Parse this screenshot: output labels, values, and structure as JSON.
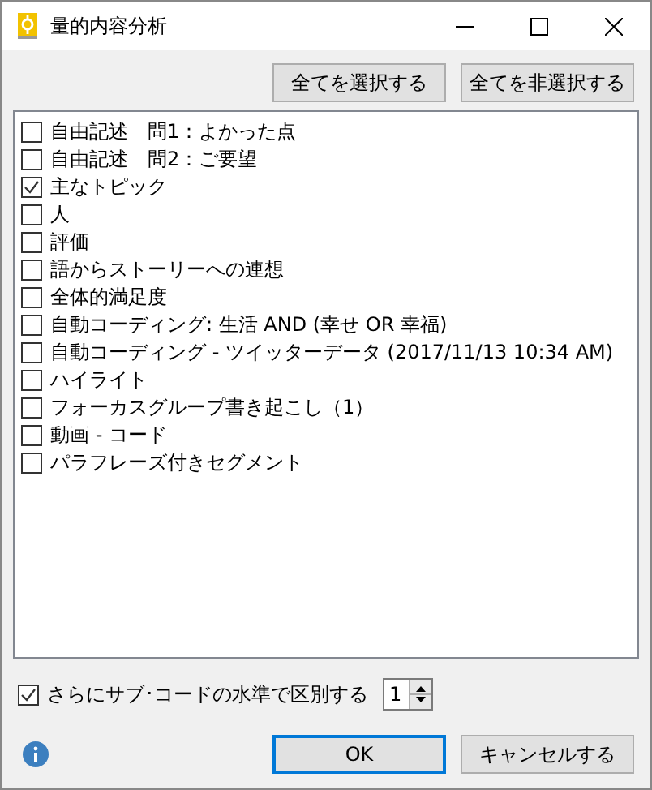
{
  "window": {
    "title": "量的内容分析"
  },
  "top_buttons": [
    "全てを選択する",
    "全てを非選択する"
  ],
  "items": [
    {
      "label": "自由記述　問1：よかった点",
      "checked": false
    },
    {
      "label": "自由記述　問2：ご要望",
      "checked": false
    },
    {
      "label": "主なトピック",
      "checked": true
    },
    {
      "label": "人",
      "checked": false
    },
    {
      "label": "評価",
      "checked": false
    },
    {
      "label": "語からストーリーへの連想",
      "checked": false
    },
    {
      "label": "全体的満足度",
      "checked": false
    },
    {
      "label": "自動コーディング: 生活 AND (幸せ OR 幸福)",
      "checked": false
    },
    {
      "label": "自動コーディング - ツイッターデータ (2017/11/13 10:34 AM)",
      "checked": false
    },
    {
      "label": "ハイライト",
      "checked": false
    },
    {
      "label": "フォーカスグループ書き起こし（1）",
      "checked": false
    },
    {
      "label": "動画 - コード",
      "checked": false
    },
    {
      "label": "パラフレーズ付きセグメント",
      "checked": false
    }
  ],
  "subcode": {
    "label": "さらにサブ･コードの水準で区別する",
    "checked": true,
    "value": "1"
  },
  "footer_buttons": [
    {
      "label": "OK",
      "default": true
    },
    {
      "label": "キャンセルする",
      "default": false
    }
  ]
}
